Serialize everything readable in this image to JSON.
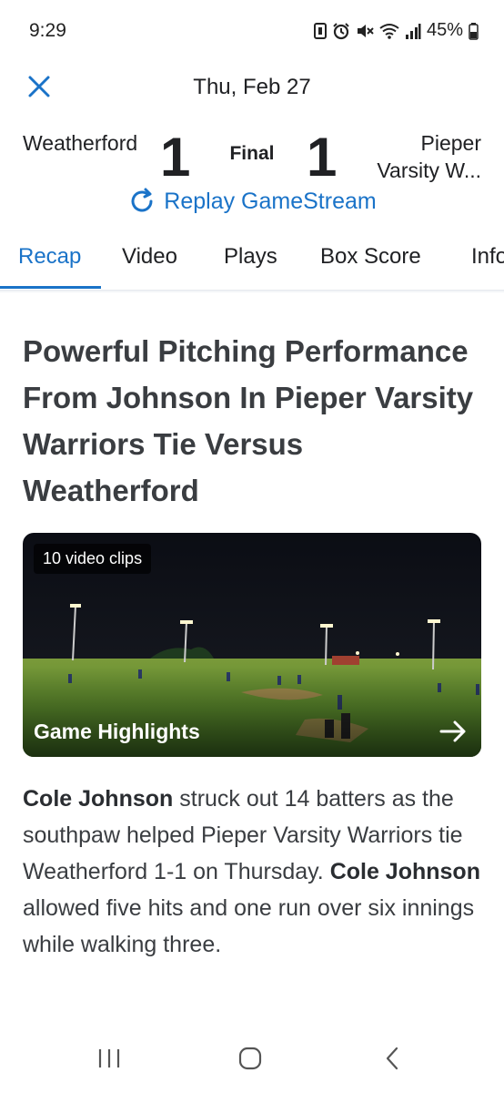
{
  "status_bar": {
    "time": "9:29",
    "battery": "45%",
    "icons": [
      "nfc-icon",
      "alarm-icon",
      "mute-icon",
      "wifi-icon",
      "signal-icon",
      "battery-icon"
    ]
  },
  "header": {
    "close_icon": "close-icon",
    "date": "Thu, Feb 27"
  },
  "scoreboard": {
    "home_team_name": "Weatherford",
    "home_score": "1",
    "status": "Final",
    "away_score": "1",
    "away_team_line1": "Pieper",
    "away_team_line2": "Varsity W..."
  },
  "replay": {
    "icon": "refresh-icon",
    "label": "Replay GameStream"
  },
  "tabs": [
    {
      "label": "Recap",
      "active": true
    },
    {
      "label": "Video",
      "active": false
    },
    {
      "label": "Plays",
      "active": false
    },
    {
      "label": "Box Score",
      "active": false
    },
    {
      "label": "Info",
      "active": false
    }
  ],
  "article": {
    "headline": "Powerful Pitching Performance From Johnson In Pieper Varsity Warriors Tie Versus Weatherford",
    "video": {
      "clips_badge": "10 video clips",
      "label": "Game Highlights",
      "arrow_icon": "arrow-right-icon"
    },
    "body": {
      "name1": "Cole Johnson",
      "text1": " struck out 14 batters as the southpaw helped Pieper Varsity Warriors tie Weatherford 1-1 on Thursday. ",
      "name2": "Cole Johnson",
      "text2": " allowed five hits and one run over six innings while walking three."
    }
  },
  "nav_bar": {
    "recents_icon": "recents-icon",
    "home_icon": "home-icon",
    "back_icon": "back-icon"
  },
  "colors": {
    "accent": "#1a73c8",
    "text_dark": "#202124",
    "headline": "#3a3d41"
  }
}
